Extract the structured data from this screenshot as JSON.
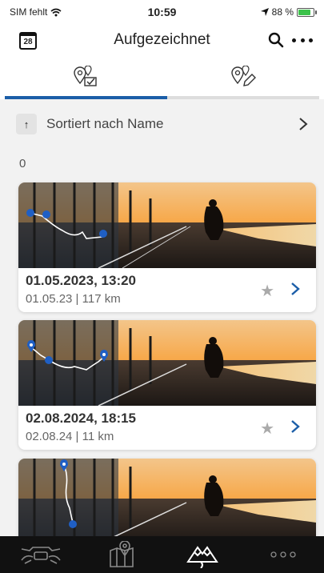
{
  "status": {
    "carrier": "SIM fehlt",
    "time": "10:59",
    "battery": "88 %",
    "battery_level": 0.88
  },
  "header": {
    "calendar_day": "28",
    "title": "Aufgezeichnet"
  },
  "tabs": [
    {
      "icon": "recorded-routes-icon",
      "active": true
    },
    {
      "icon": "planned-routes-icon",
      "active": false
    }
  ],
  "sort": {
    "label": "Sortiert nach Name"
  },
  "count": "0",
  "rides": [
    {
      "title": "01.05.2023, 13:20",
      "subtitle": "01.05.23 | 117 km"
    },
    {
      "title": "02.08.2024, 18:15",
      "subtitle": "02.08.24 | 11 km"
    },
    {
      "title": "",
      "subtitle": ""
    }
  ],
  "bottom_tabs": [
    {
      "icon": "motorcycle-icon",
      "active": false
    },
    {
      "icon": "map-icon",
      "active": false
    },
    {
      "icon": "mountains-icon",
      "active": true
    },
    {
      "icon": "more-icon",
      "active": false
    }
  ],
  "colors": {
    "accent": "#1b5ea8",
    "route_dot": "#1f5fc4",
    "tabbar": "#111111"
  }
}
